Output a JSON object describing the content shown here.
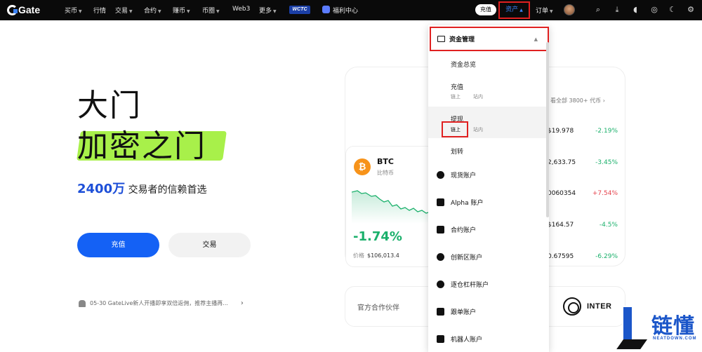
{
  "nav": {
    "brand": "Gate",
    "items": [
      {
        "label": "买币",
        "caret": true
      },
      {
        "label": "行情",
        "caret": false
      },
      {
        "label": "交易",
        "caret": true
      },
      {
        "label": "合约",
        "caret": true
      },
      {
        "label": "赚币",
        "caret": true
      },
      {
        "label": "币圈",
        "caret": true
      },
      {
        "label": "Web3",
        "caret": false
      },
      {
        "label": "更多",
        "caret": true
      }
    ],
    "event_badge": "WCTC",
    "welfare": "福利中心",
    "deposit": "充值",
    "assets": "资产",
    "orders": "订单",
    "icons": [
      "search-icon",
      "download-icon",
      "bell-icon",
      "globe-icon",
      "moon-icon",
      "gear-icon"
    ]
  },
  "hero": {
    "line1": "大门",
    "line2": "加密之门",
    "count": "2400万",
    "tagline": "交易者的信赖首选",
    "deposit_button": "充值",
    "trade_button": "交易",
    "notice": "05-30 GateLive新人开播即享双倍返佣，推荐主播再..."
  },
  "btc": {
    "symbol": "BTC",
    "name": "比特币",
    "change": "-1.74%",
    "price_label": "价格",
    "price": "$106,013.4"
  },
  "market": {
    "header": "看全部 3800+ 代币",
    "rows": [
      {
        "price": "$19.978",
        "change": "-2.19%",
        "dir": "down"
      },
      {
        "price": "2,633.75",
        "change": "-3.45%",
        "dir": "down"
      },
      {
        "price": "0060354",
        "change": "+7.54%",
        "dir": "up"
      },
      {
        "price": "$164.57",
        "change": "-4.5%",
        "dir": "down"
      },
      {
        "price": "0.67595",
        "change": "-6.29%",
        "dir": "down"
      }
    ]
  },
  "partner": {
    "label": "官方合作伙伴",
    "name": "INTER"
  },
  "dropdown": {
    "header": "资金管理",
    "sub_items": [
      {
        "label": "资金总览"
      },
      {
        "label": "充值",
        "sub": [
          "链上",
          "站内"
        ]
      },
      {
        "label": "提现",
        "sub": [
          "链上",
          "站内"
        ]
      },
      {
        "label": "划转"
      }
    ],
    "accounts": [
      "现货账户",
      "Alpha 账户",
      "合约账户",
      "创新区账户",
      "逐仓杠杆账户",
      "跟单账户",
      "机器人账户"
    ]
  },
  "watermark": {
    "text": "链懂",
    "url": "NEATDOWN.COM"
  },
  "colors": {
    "accent": "#1461f5",
    "highlight": "#a8f04a",
    "annotation_red": "#e02020",
    "positive": "#1ab06b",
    "negative": "#e5434d"
  }
}
